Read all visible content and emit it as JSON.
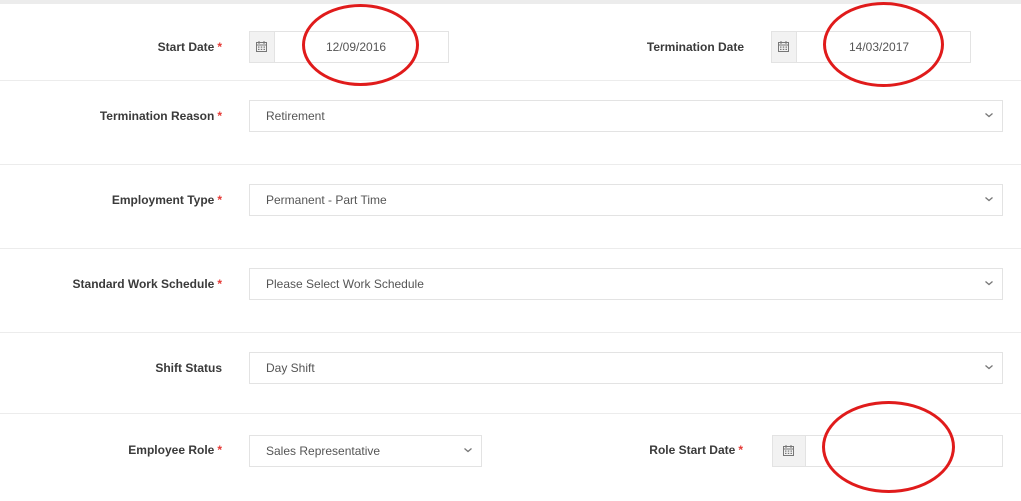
{
  "form": {
    "start_date": {
      "label": "Start Date",
      "required_mark": "*",
      "value": "12/09/2016",
      "icon": "calendar-icon"
    },
    "termination_date": {
      "label": "Termination Date",
      "value": "14/03/2017",
      "icon": "calendar-icon"
    },
    "termination_reason": {
      "label": "Termination Reason",
      "required_mark": "*",
      "value": "Retirement"
    },
    "employment_type": {
      "label": "Employment Type",
      "required_mark": "*",
      "value": "Permanent - Part Time"
    },
    "standard_work_schedule": {
      "label": "Standard Work Schedule",
      "required_mark": "*",
      "value": "Please Select Work Schedule"
    },
    "shift_status": {
      "label": "Shift Status",
      "value": "Day Shift"
    },
    "employee_role": {
      "label": "Employee Role",
      "required_mark": "*",
      "value": "Sales Representative"
    },
    "role_start_date": {
      "label": "Role Start Date",
      "required_mark": "*",
      "value": "",
      "icon": "calendar-icon"
    }
  },
  "colors": {
    "required": "#e53935",
    "annotation_circle": "#e01b1b",
    "label_text": "#3a3a3a",
    "field_text": "#555555",
    "border": "#e3e3e3"
  }
}
